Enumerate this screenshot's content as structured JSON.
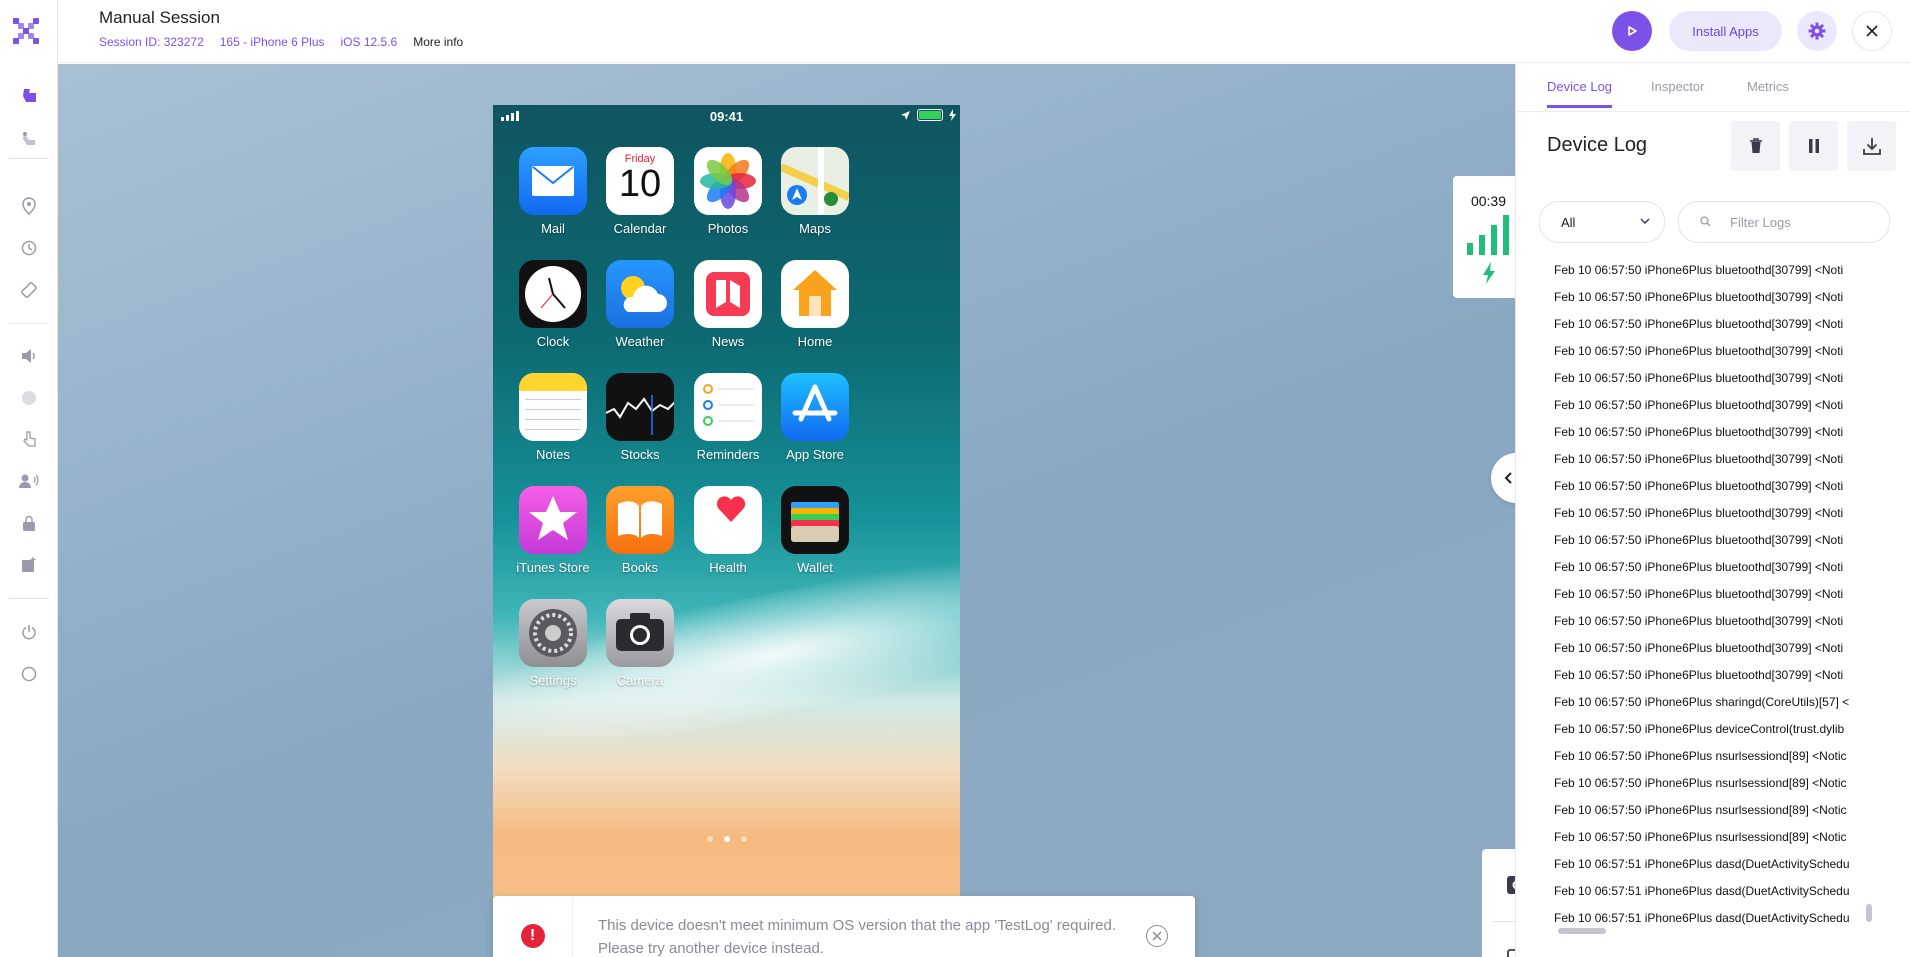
{
  "header": {
    "title": "Manual Session",
    "session_id": "Session ID: 323272",
    "device": "165 - iPhone 6 Plus",
    "os": "iOS 12.5.6",
    "more_info": "More info",
    "install_apps": "Install Apps"
  },
  "sidebar": {
    "icons": [
      "touch-icon",
      "gesture-icon",
      "location-icon",
      "history-icon",
      "rotate-icon",
      "volume-icon",
      "biometric-icon",
      "tap-icon",
      "voice-icon",
      "lock-icon",
      "image-inject-icon",
      "power-icon",
      "home-button-icon"
    ]
  },
  "device": {
    "time": "09:41",
    "apps": [
      {
        "label": "Mail",
        "icon": "mail-icon"
      },
      {
        "label": "Calendar",
        "icon": "calendar-icon",
        "day_name": "Friday",
        "day_number": "10"
      },
      {
        "label": "Photos",
        "icon": "photos-icon"
      },
      {
        "label": "Maps",
        "icon": "maps-icon"
      },
      {
        "label": "Clock",
        "icon": "clock-icon"
      },
      {
        "label": "Weather",
        "icon": "weather-icon"
      },
      {
        "label": "News",
        "icon": "news-icon"
      },
      {
        "label": "Home",
        "icon": "home-icon"
      },
      {
        "label": "Notes",
        "icon": "notes-icon"
      },
      {
        "label": "Stocks",
        "icon": "stocks-icon"
      },
      {
        "label": "Reminders",
        "icon": "reminders-icon"
      },
      {
        "label": "App Store",
        "icon": "appstore-icon"
      },
      {
        "label": "iTunes Store",
        "icon": "itunes-icon"
      },
      {
        "label": "Books",
        "icon": "books-icon"
      },
      {
        "label": "Health",
        "icon": "health-icon"
      },
      {
        "label": "Wallet",
        "icon": "wallet-icon"
      },
      {
        "label": "Settings",
        "icon": "settings-icon"
      },
      {
        "label": "Camera",
        "icon": "camera-icon"
      }
    ],
    "page_count": 3,
    "current_page": 2
  },
  "timer": {
    "elapsed": "00:39"
  },
  "tools": {
    "badge_count": "0"
  },
  "toast": {
    "message": "This device doesn't meet minimum OS version that the app 'TestLog' required. Please try another device instead."
  },
  "panel": {
    "tabs": [
      "Device Log",
      "Inspector",
      "Metrics"
    ],
    "active_tab": "Device Log",
    "title": "Device Log",
    "filter_select": "All",
    "filter_placeholder": "Filter Logs",
    "log_lines": [
      "Feb 10 06:57:50 iPhone6Plus bluetoothd[30799] <Noti",
      "Feb 10 06:57:50 iPhone6Plus bluetoothd[30799] <Noti",
      "Feb 10 06:57:50 iPhone6Plus bluetoothd[30799] <Noti",
      "Feb 10 06:57:50 iPhone6Plus bluetoothd[30799] <Noti",
      "Feb 10 06:57:50 iPhone6Plus bluetoothd[30799] <Noti",
      "Feb 10 06:57:50 iPhone6Plus bluetoothd[30799] <Noti",
      "Feb 10 06:57:50 iPhone6Plus bluetoothd[30799] <Noti",
      "Feb 10 06:57:50 iPhone6Plus bluetoothd[30799] <Noti",
      "Feb 10 06:57:50 iPhone6Plus bluetoothd[30799] <Noti",
      "Feb 10 06:57:50 iPhone6Plus bluetoothd[30799] <Noti",
      "Feb 10 06:57:50 iPhone6Plus bluetoothd[30799] <Noti",
      "Feb 10 06:57:50 iPhone6Plus bluetoothd[30799] <Noti",
      "Feb 10 06:57:50 iPhone6Plus bluetoothd[30799] <Noti",
      "Feb 10 06:57:50 iPhone6Plus bluetoothd[30799] <Noti",
      "Feb 10 06:57:50 iPhone6Plus bluetoothd[30799] <Noti",
      "Feb 10 06:57:50 iPhone6Plus bluetoothd[30799] <Noti",
      "Feb 10 06:57:50 iPhone6Plus sharingd(CoreUtils)[57] <",
      "Feb 10 06:57:50 iPhone6Plus deviceControl(trust.dylib",
      "Feb 10 06:57:50 iPhone6Plus nsurlsessiond[89] <Notic",
      "Feb 10 06:57:50 iPhone6Plus nsurlsessiond[89] <Notic",
      "Feb 10 06:57:50 iPhone6Plus nsurlsessiond[89] <Notic",
      "Feb 10 06:57:50 iPhone6Plus nsurlsessiond[89] <Notic",
      "Feb 10 06:57:51 iPhone6Plus dasd(DuetActivitySchedu",
      "Feb 10 06:57:51 iPhone6Plus dasd(DuetActivitySchedu",
      "Feb 10 06:57:51 iPhone6Plus dasd(DuetActivitySchedu"
    ]
  },
  "colors": {
    "accent": "#7a52e8",
    "error": "#e5243b",
    "battery": "#35d158",
    "signal": "#1fbf7a"
  }
}
